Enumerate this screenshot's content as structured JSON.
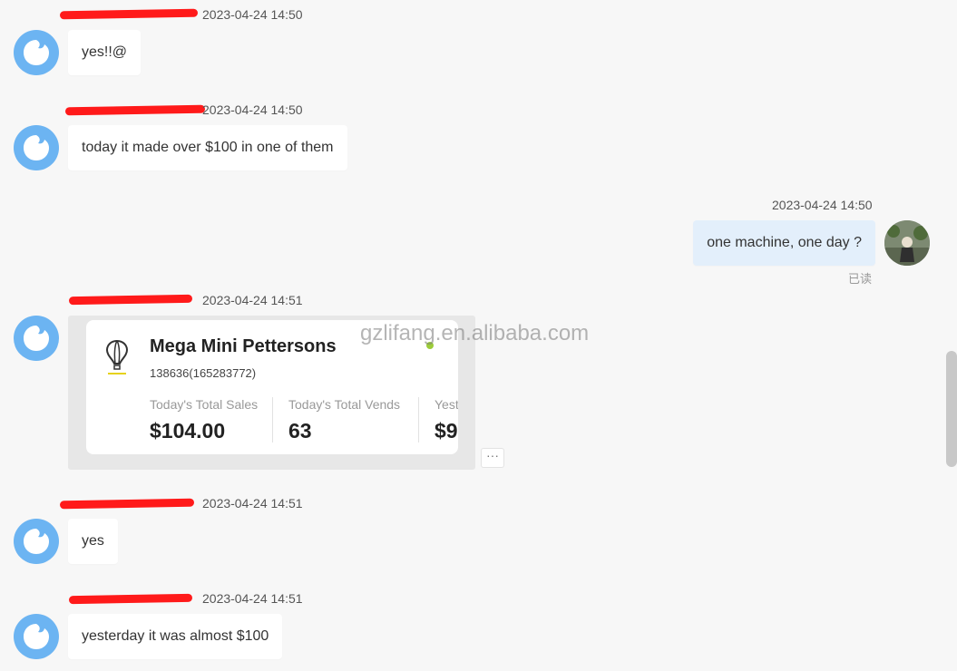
{
  "messages": [
    {
      "time": "2023-04-24 14:50",
      "text": "yes!!@"
    },
    {
      "time": "2023-04-24 14:50",
      "text": "today it made over $100 in one of them"
    },
    {
      "time": "2023-04-24 14:50",
      "text": "one machine, one day ?",
      "read_status": "已读"
    },
    {
      "time": "2023-04-24 14:51"
    },
    {
      "time": "2023-04-24 14:51",
      "text": "yes"
    },
    {
      "time": "2023-04-24 14:51",
      "text": "yesterday it was almost $100"
    }
  ],
  "card": {
    "title": "Mega Mini Pettersons",
    "subtitle": "138636(165283772)",
    "stats": [
      {
        "label": "Today's Total Sales",
        "value": "$104.00"
      },
      {
        "label": "Today's Total Vends",
        "value": "63"
      },
      {
        "label": "Yest",
        "value": "$9"
      }
    ],
    "icon": "hot-air-balloon-icon",
    "status_color": "#9ccc3a"
  },
  "watermark": "gzlifang.en.alibaba.com",
  "more_button": "···",
  "colors": {
    "background": "#f7f7f7",
    "bubble_received": "#ffffff",
    "bubble_sent": "#e3effb",
    "avatar": "#6cb4f2",
    "redaction": "#ff1a1a"
  }
}
